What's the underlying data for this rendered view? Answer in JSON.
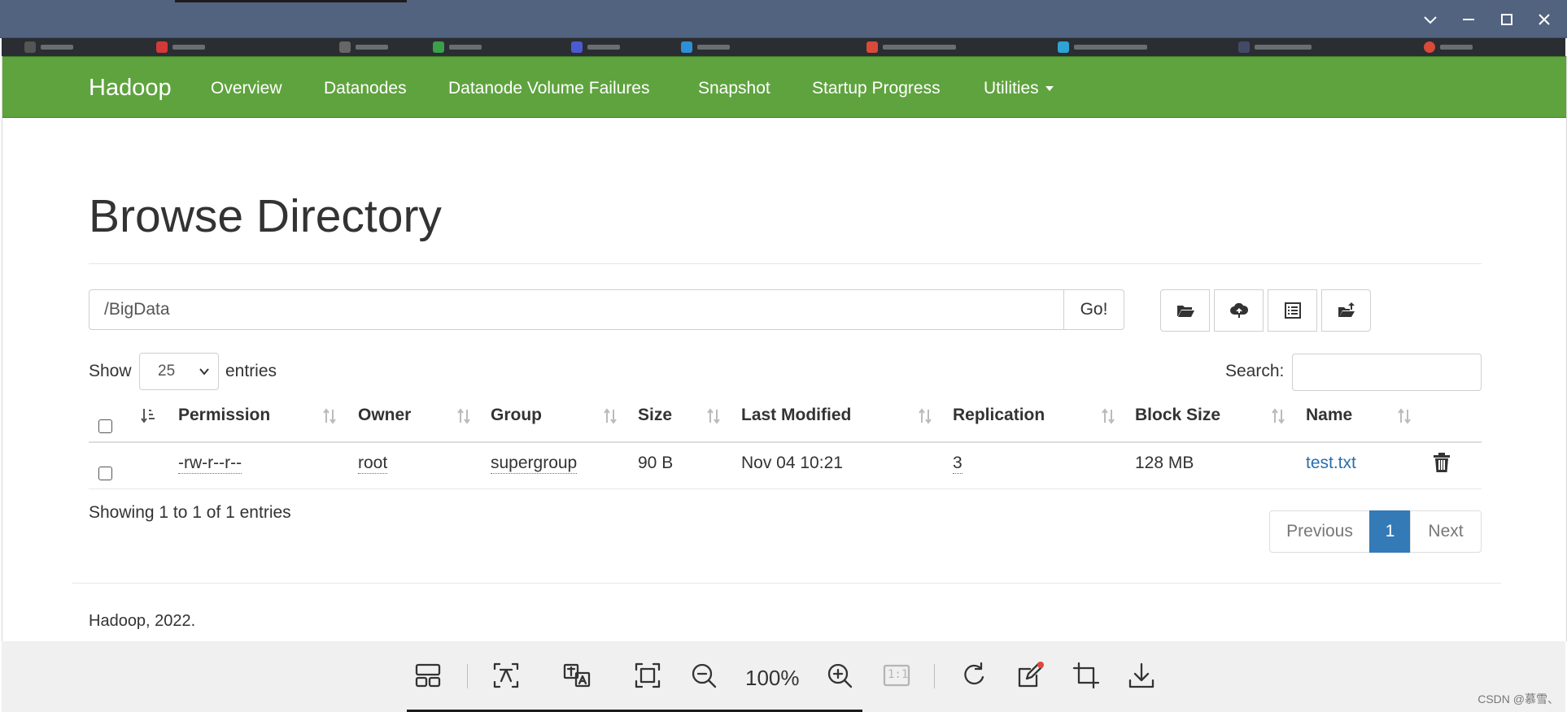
{
  "navbar": {
    "brand": "Hadoop",
    "items": [
      {
        "label": "Overview"
      },
      {
        "label": "Datanodes"
      },
      {
        "label": "Datanode Volume Failures"
      },
      {
        "label": "Snapshot"
      },
      {
        "label": "Startup Progress"
      },
      {
        "label": "Utilities"
      }
    ]
  },
  "page": {
    "title": "Browse Directory",
    "path_value": "/BigData",
    "go_label": "Go!"
  },
  "table_controls": {
    "show_label": "Show",
    "entries_value": "25",
    "entries_label": "entries",
    "search_label": "Search:"
  },
  "table": {
    "columns": [
      "Permission",
      "Owner",
      "Group",
      "Size",
      "Last Modified",
      "Replication",
      "Block Size",
      "Name"
    ],
    "rows": [
      {
        "permission": "-rw-r--r--",
        "owner": "root",
        "group": "supergroup",
        "size": "90 B",
        "last_modified": "Nov 04 10:21",
        "replication": "3",
        "block_size": "128 MB",
        "name": "test.txt"
      }
    ]
  },
  "footer_info": "Showing 1 to 1 of 1 entries",
  "pagination": {
    "previous": "Previous",
    "current": "1",
    "next": "Next"
  },
  "footer": "Hadoop, 2022.",
  "viewer": {
    "zoom": "100%",
    "one_to_one": "1:1",
    "watermark": "CSDN @慕雪、"
  },
  "colors": {
    "navbar": "#5fa33e",
    "titlebar": "#51637f",
    "link": "#2a6ead",
    "active_page": "#337ab7"
  }
}
